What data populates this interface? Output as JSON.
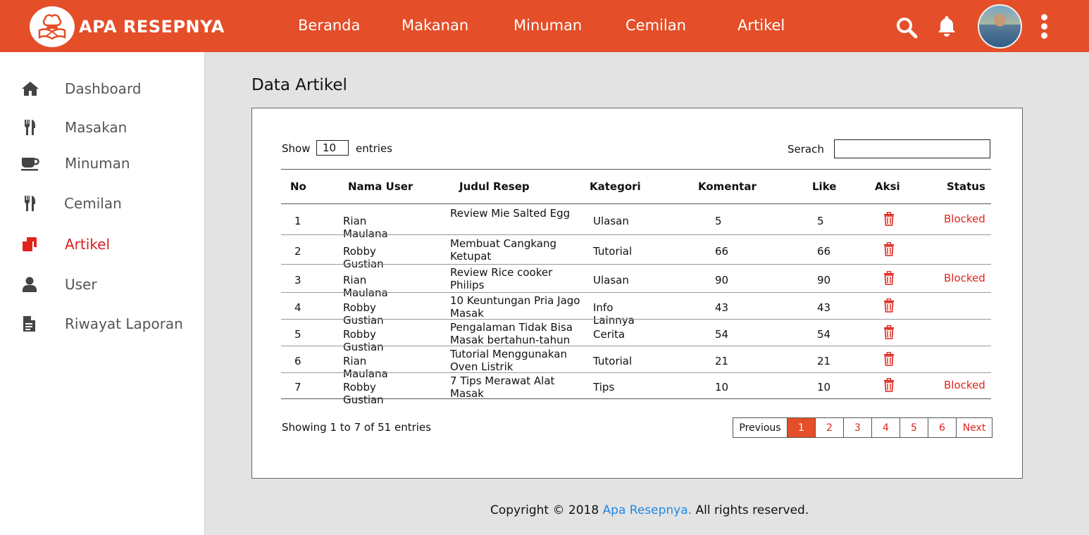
{
  "brand": {
    "name": "APA RESEPNYA"
  },
  "nav": [
    {
      "label": "Beranda"
    },
    {
      "label": "Makanan"
    },
    {
      "label": "Minuman"
    },
    {
      "label": "Cemilan"
    },
    {
      "label": "Artikel"
    }
  ],
  "top_icons": [
    "search-icon",
    "bell-icon",
    "avatar",
    "more-vertical-icon"
  ],
  "sidebar": {
    "items": [
      {
        "label": "Dashboard",
        "icon": "home-icon"
      },
      {
        "label": "Masakan",
        "icon": "utensils-icon"
      },
      {
        "label": "Minuman",
        "icon": "coffee-cup-icon"
      },
      {
        "label": "Cemilan",
        "icon": "utensils-icon"
      },
      {
        "label": "Artikel",
        "icon": "articles-icon",
        "active": true
      },
      {
        "label": "User",
        "icon": "user-icon"
      },
      {
        "label": "Riwayat Laporan",
        "icon": "document-icon"
      }
    ]
  },
  "main": {
    "title": "Data Artikel",
    "show_label": "Show",
    "show_value": "10",
    "entries_label": "entries",
    "search_label": "Serach",
    "search_value": "",
    "columns": [
      "No",
      "Nama User",
      "Judul Resep",
      "Kategori",
      "Komentar",
      "Like",
      "Aksi",
      "Status"
    ],
    "rows": [
      {
        "no": "1",
        "user": "Rian Maulana",
        "judul": "Review Mie Salted Egg",
        "kategori": "Ulasan",
        "komentar": "5",
        "like": "5",
        "status": "Blocked"
      },
      {
        "no": "2",
        "user": "Robby Gustian",
        "judul": "Membuat Cangkang Ketupat",
        "kategori": "Tutorial",
        "komentar": "66",
        "like": "66",
        "status": ""
      },
      {
        "no": "3",
        "user": "Rian Maulana",
        "judul": "Review Rice cooker Philips",
        "kategori": "Ulasan",
        "komentar": "90",
        "like": "90",
        "status": "Blocked"
      },
      {
        "no": "4",
        "user": "Robby Gustian",
        "judul": "10 Keuntungan Pria Jago Masak",
        "kategori": "Info Lainnya",
        "komentar": "43",
        "like": "43",
        "status": ""
      },
      {
        "no": "5",
        "user": "Robby Gustian",
        "judul": "Pengalaman Tidak Bisa Masak bertahun-tahun",
        "kategori": "Cerita",
        "komentar": "54",
        "like": "54",
        "status": ""
      },
      {
        "no": "6",
        "user": "Rian Maulana",
        "judul": "Tutorial Menggunakan Oven Listrik",
        "kategori": "Tutorial",
        "komentar": "21",
        "like": "21",
        "status": ""
      },
      {
        "no": "7",
        "user": "Robby Gustian",
        "judul": "7 Tips Merawat Alat Masak",
        "kategori": "Tips",
        "komentar": "10",
        "like": "10",
        "status": "Blocked"
      }
    ],
    "showing_text": "Showing 1 to 7 of 51 entries",
    "pagination": {
      "previous": "Previous",
      "pages": [
        "1",
        "2",
        "3",
        "4",
        "5",
        "6"
      ],
      "current": "1",
      "next": "Next"
    }
  },
  "footer": {
    "prefix": "Copyright © 2018 ",
    "brand_link": "Apa Resepnya.",
    "suffix": " All rights reserved."
  },
  "colors": {
    "accent": "#e44e28",
    "danger": "#e0241d",
    "link": "#1e88e5"
  }
}
